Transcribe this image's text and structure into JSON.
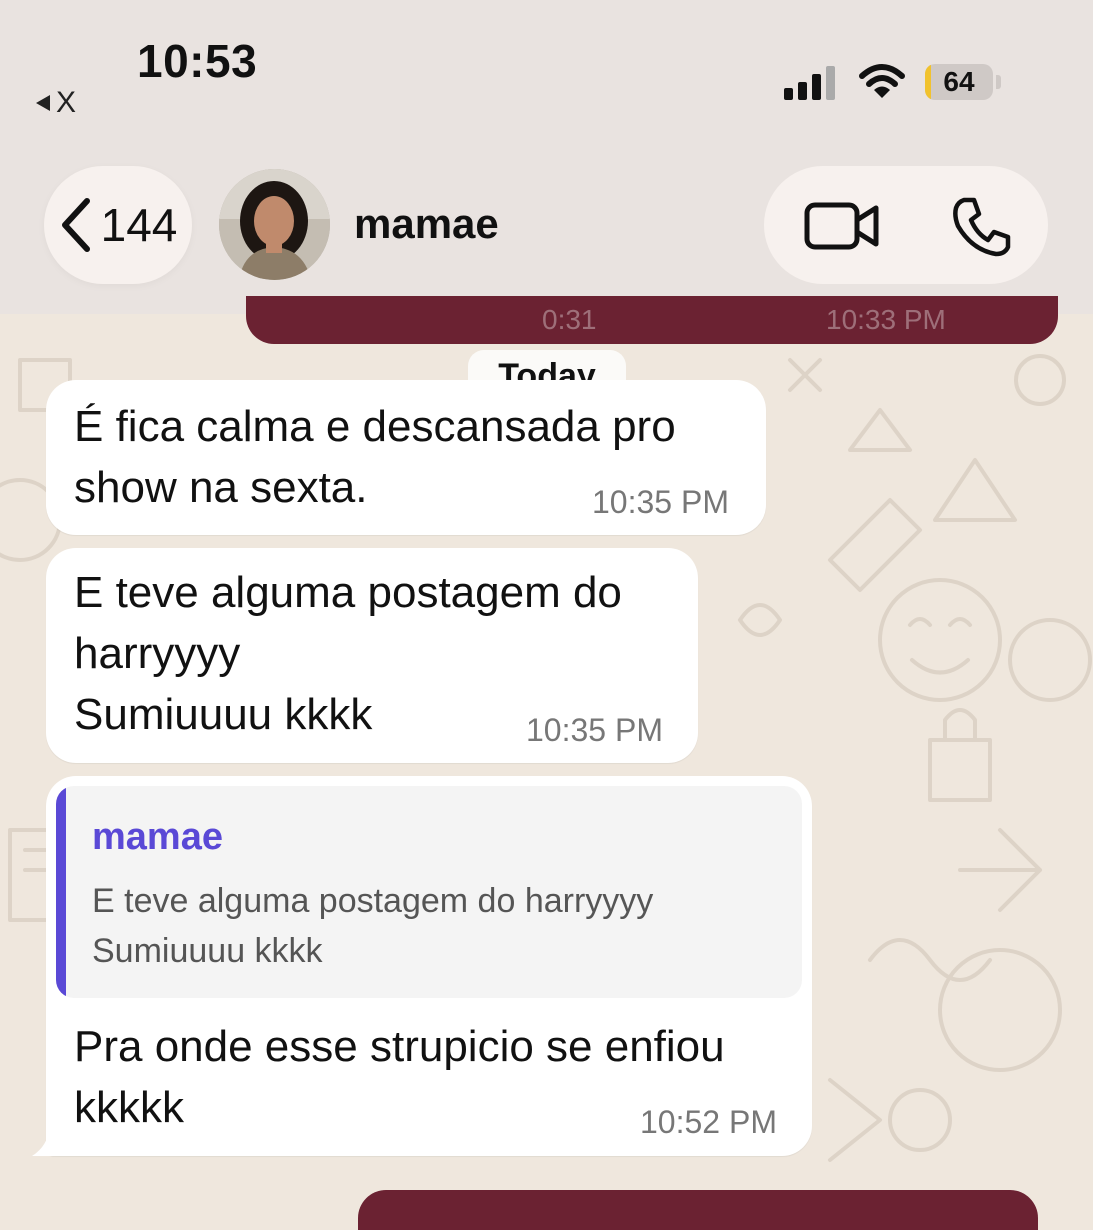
{
  "status_bar": {
    "time": "10:53",
    "back_app": "X",
    "battery": "64"
  },
  "header": {
    "back_count": "144",
    "contact_name": "mamae"
  },
  "chat": {
    "outgoing_top_fragment_left": "0:31",
    "outgoing_top_fragment_right": "10:33 PM",
    "date_label": "Today",
    "messages": [
      {
        "text": "É  fica calma e descansada pro\nshow  na sexta.",
        "time": "10:35 PM"
      },
      {
        "text": "E teve alguma postagem do\nharryyyy\nSumiuuuu kkkk",
        "time": "10:35 PM"
      },
      {
        "reply_to": {
          "name": "mamae",
          "text": "E teve alguma postagem do harryyyy\nSumiuuuu kkkk"
        },
        "text": "Pra onde esse strupicio se enfiou\nkkkkk",
        "time": "10:52 PM"
      }
    ]
  },
  "colors": {
    "outgoing_bubble": "#6b2232",
    "incoming_bubble": "#ffffff",
    "quote_accent": "#5a49d6",
    "chat_background": "#efe7dd"
  },
  "icons": [
    "back-chevron-icon",
    "video-call-icon",
    "phone-call-icon",
    "signal-icon",
    "wifi-icon",
    "battery-icon"
  ]
}
